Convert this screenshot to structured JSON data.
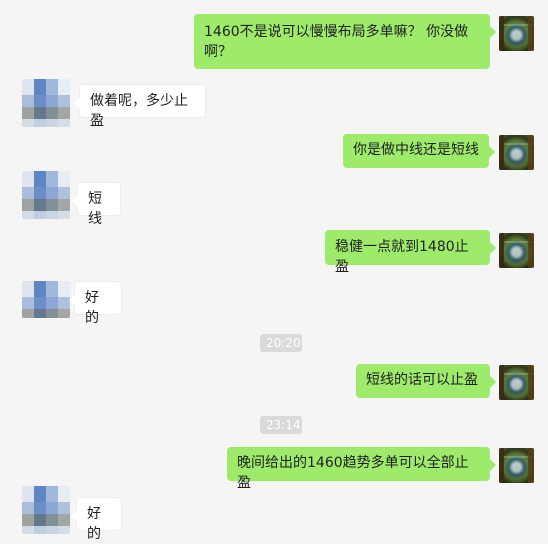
{
  "chat": {
    "messages": [
      {
        "from": "me",
        "text": "1460不是说可以慢慢布局多单嘛？ 你没做啊？"
      },
      {
        "from": "other",
        "text": "做着呢，多少止盈"
      },
      {
        "from": "me",
        "text": "你是做中线还是短线"
      },
      {
        "from": "other",
        "text": "短线"
      },
      {
        "from": "me",
        "text": "稳健一点就到1480止盈"
      },
      {
        "from": "other",
        "text": "好的"
      },
      {
        "from": "time",
        "text": "20:20"
      },
      {
        "from": "me",
        "text": "短线的话可以止盈"
      },
      {
        "from": "time",
        "text": "23:14"
      },
      {
        "from": "me",
        "text": "晚间给出的1460趋势多单可以全部止盈"
      },
      {
        "from": "other",
        "text": "好的"
      }
    ]
  },
  "colors": {
    "background": "#f5f5f5",
    "outgoing_bubble": "#9eea6a",
    "incoming_bubble": "#ffffff",
    "timestamp_pill": "#dadada"
  },
  "icons": {
    "my_avatar": "avatar-image",
    "contact_avatar": "avatar-image-pixelated"
  }
}
